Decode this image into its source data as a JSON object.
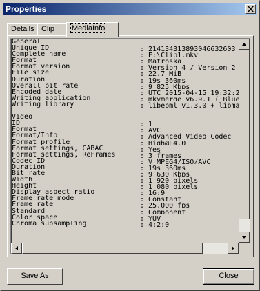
{
  "window": {
    "title": "Properties"
  },
  "tabs": [
    {
      "label": "Details"
    },
    {
      "label": "Clip"
    },
    {
      "label": "MediaInfo"
    }
  ],
  "info_lines": [
    {
      "key": "General",
      "value": ""
    },
    {
      "key": "Unique ID",
      "value": ": 214134313893046632603"
    },
    {
      "key": "Complete name",
      "value": ": E:\\Clip1.mkv"
    },
    {
      "key": "Format",
      "value": ": Matroska"
    },
    {
      "key": "Format version",
      "value": ": Version 4 / Version 2"
    },
    {
      "key": "File size",
      "value": ": 22.7 MiB"
    },
    {
      "key": "Duration",
      "value": ": 19s 360ms"
    },
    {
      "key": "Overall bit rate",
      "value": ": 9 825 Kbps"
    },
    {
      "key": "Encoded date",
      "value": ": UTC 2015-04-15 19:32:2"
    },
    {
      "key": "Writing application",
      "value": ": mkvmerge v6.9.1 ('Blue"
    },
    {
      "key": "Writing library",
      "value": ": libebml v1.3.0 + libma"
    },
    {
      "key": "",
      "value": ""
    },
    {
      "key": "Video",
      "value": ""
    },
    {
      "key": "ID",
      "value": ": 1"
    },
    {
      "key": "Format",
      "value": ": AVC"
    },
    {
      "key": "Format/Info",
      "value": ": Advanced Video Codec"
    },
    {
      "key": "Format profile",
      "value": ": High@L4.0"
    },
    {
      "key": "Format settings, CABAC",
      "value": ": Yes"
    },
    {
      "key": "Format settings, ReFrames",
      "value": ": 3 frames"
    },
    {
      "key": "Codec ID",
      "value": ": V_MPEG4/ISO/AVC"
    },
    {
      "key": "Duration",
      "value": ": 19s 360ms"
    },
    {
      "key": "Bit rate",
      "value": ": 9 630 Kbps"
    },
    {
      "key": "Width",
      "value": ": 1 920 pixels"
    },
    {
      "key": "Height",
      "value": ": 1 080 pixels"
    },
    {
      "key": "Display aspect ratio",
      "value": ": 16:9"
    },
    {
      "key": "Frame rate mode",
      "value": ": Constant"
    },
    {
      "key": "Frame rate",
      "value": ": 25.000 fps"
    },
    {
      "key": "Standard",
      "value": ": Component"
    },
    {
      "key": "Color space",
      "value": ": YUV"
    },
    {
      "key": "Chroma subsampling",
      "value": ": 4:2:0"
    }
  ],
  "buttons": {
    "save_as": "Save As",
    "close": "Close"
  },
  "colors": {
    "title_start": "#0a246a",
    "title_end": "#a6caf0",
    "face": "#d4d0c8"
  },
  "icons": {
    "close": "x-close-icon",
    "scroll_up": "triangle-up-icon",
    "scroll_down": "triangle-down-icon",
    "scroll_left": "triangle-left-icon",
    "scroll_right": "triangle-right-icon"
  }
}
